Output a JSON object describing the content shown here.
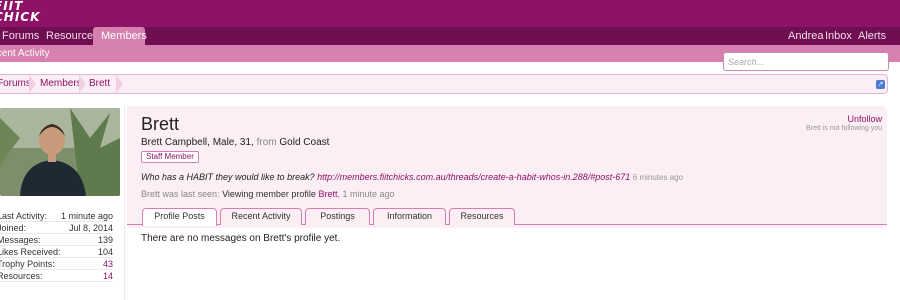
{
  "header": {
    "logo_line1": "FIIT",
    "logo_line2": "CHICK"
  },
  "nav": {
    "tabs": [
      {
        "label": "Forums"
      },
      {
        "label": "Resources"
      },
      {
        "label": "Members"
      }
    ],
    "right": [
      {
        "label": "Andrea"
      },
      {
        "label": "Inbox"
      },
      {
        "label": "Alerts"
      }
    ],
    "subnav_item": "Recent Activity"
  },
  "search": {
    "placeholder": "Search..."
  },
  "breadcrumb": [
    {
      "label": "Forums"
    },
    {
      "label": "Members"
    },
    {
      "label": "Brett"
    }
  ],
  "sidebar": {
    "stats": [
      {
        "label": "Last Activity:",
        "value": "1 minute ago"
      },
      {
        "label": "Joined:",
        "value": "Jul 8, 2014"
      },
      {
        "label": "Messages:",
        "value": "139"
      },
      {
        "label": "Likes Received:",
        "value": "104"
      },
      {
        "label": "Trophy Points:",
        "value": "43"
      },
      {
        "label": "Resources:",
        "value": "14"
      }
    ]
  },
  "profile": {
    "name": "Brett",
    "info_prefix": "Brett Campbell, Male, 31, ",
    "info_from": "from",
    "info_location": "Gold Coast",
    "badge": "Staff Member",
    "status_text": "Who has a HABIT they would like to break?",
    "status_link": "http://members.fiitchicks.com.au/threads/create-a-habit-whos-in.288/#post-671",
    "status_time": "6 minutes ago",
    "seen_prefix": "Brett was last seen:",
    "seen_action": "Viewing member profile",
    "seen_user": "Brett",
    "seen_time": ", 1 minute ago",
    "unfollow": "Unfollow",
    "not_following": "Brett is not following you"
  },
  "tabs": [
    {
      "label": "Profile Posts"
    },
    {
      "label": "Recent Activity"
    },
    {
      "label": "Postings"
    },
    {
      "label": "Information"
    },
    {
      "label": "Resources"
    }
  ],
  "empty_message": "There are no messages on Brett's profile yet."
}
